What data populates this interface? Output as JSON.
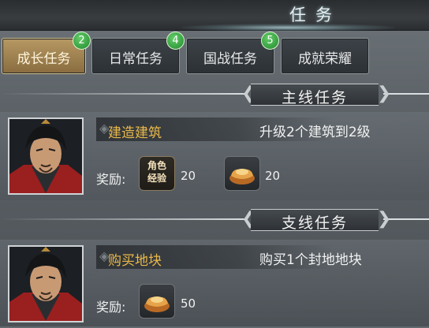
{
  "window": {
    "title": "任务"
  },
  "tabs": [
    {
      "label": "成长任务",
      "badge": "2",
      "active": true
    },
    {
      "label": "日常任务",
      "badge": "4",
      "active": false
    },
    {
      "label": "国战任务",
      "badge": "5",
      "active": false
    },
    {
      "label": "成就荣耀",
      "badge": "",
      "active": false
    }
  ],
  "sections": [
    {
      "title": "主线任务",
      "task": {
        "name": "建造建筑",
        "description": "升级2个建筑到2级",
        "reward_label": "奖励:",
        "rewards": [
          {
            "icon": "experience-icon",
            "icon_text": "角色经验",
            "count": "20"
          },
          {
            "icon": "gold-ingot-icon",
            "count": "20"
          }
        ]
      }
    },
    {
      "title": "支线任务",
      "task": {
        "name": "购买地块",
        "description": "购买1个封地地块",
        "reward_label": "奖励:",
        "rewards": [
          {
            "icon": "gold-ingot-icon",
            "count": "50"
          }
        ]
      }
    }
  ],
  "colors": {
    "task_name": "#e9b84a",
    "badge": "#2ea23a",
    "active_tab": "#a88a55"
  }
}
